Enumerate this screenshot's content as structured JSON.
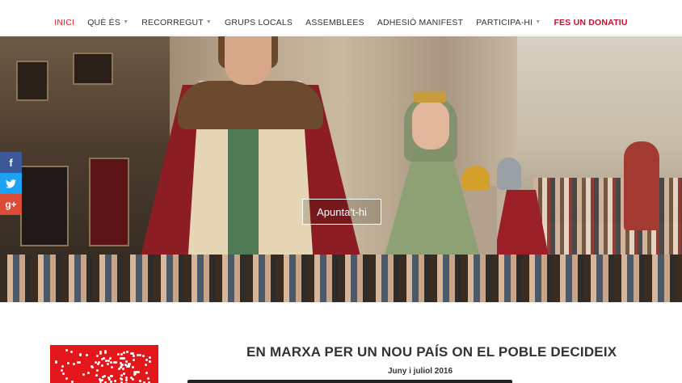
{
  "nav": {
    "items": [
      {
        "label": "INICI",
        "dropdown": false
      },
      {
        "label": "QUÈ ÉS",
        "dropdown": true
      },
      {
        "label": "RECORREGUT",
        "dropdown": true
      },
      {
        "label": "GRUPS LOCALS",
        "dropdown": false
      },
      {
        "label": "ASSEMBLEES",
        "dropdown": false
      },
      {
        "label": "ADHESIÓ MANIFEST",
        "dropdown": false
      },
      {
        "label": "PARTICIPA-HI",
        "dropdown": true
      },
      {
        "label": "FES UN DONATIU",
        "dropdown": false
      }
    ],
    "active": "INICI",
    "caret": "▼"
  },
  "hero": {
    "cta_label": "Apunta't-hi"
  },
  "social": {
    "facebook": "f",
    "twitter": "t",
    "googleplus": "g+"
  },
  "content": {
    "headline": "EN MARXA PER UN NOU PAÍS ON EL POBLE DECIDEIX",
    "subline": "Juny i juliol 2016"
  },
  "colors": {
    "accent": "#d9201f",
    "donate": "#c8102e",
    "facebook": "#3b5998",
    "twitter": "#1da1f2",
    "googleplus": "#dd4b39"
  }
}
